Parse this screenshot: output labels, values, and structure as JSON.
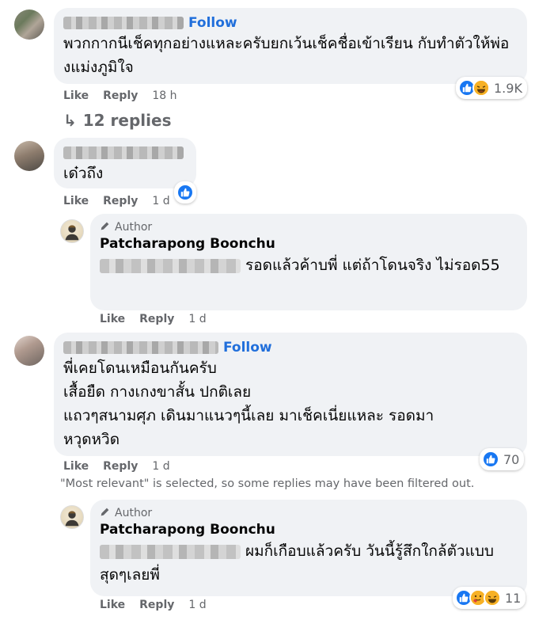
{
  "comments": [
    {
      "follow": "Follow",
      "text": "พวกกากนีเช็คทุกอย่างแหละครับยกเว้นเช็คชื่อเข้าเรียน กับทำตัวให้พ่องแม่งภูมิใจ",
      "actions": {
        "like": "Like",
        "reply": "Reply",
        "time": "18 h"
      },
      "reaction_count": "1.9K",
      "reaction_icons": [
        "like-icon",
        "haha-icon"
      ],
      "replies_link": "12 replies"
    },
    {
      "text": "เด๋วถึง",
      "actions": {
        "like": "Like",
        "reply": "Reply",
        "time": "1 d"
      },
      "reaction_icons": [
        "like-icon"
      ]
    },
    {
      "badge": "Author",
      "name": "Patcharapong Boonchu",
      "text": "รอดแล้วค้าบพี่ แต่ถ้าโดนจริง ไม่รอด55",
      "actions": {
        "like": "Like",
        "reply": "Reply",
        "time": "1 d"
      }
    },
    {
      "follow": "Follow",
      "lines": [
        "พี่เคยโดนเหมือนกันครับ",
        "เสื้อยืด กางเกงขาสั้น ปกติเลย",
        "แถวๆสนามศุภ เดินมาแนวๆนี้เลย มาเช็คเนี่ยแหละ รอดมา",
        "หวุดหวิด"
      ],
      "actions": {
        "like": "Like",
        "reply": "Reply",
        "time": "1 d"
      },
      "reaction_count": "70",
      "reaction_icons": [
        "like-icon"
      ]
    },
    {
      "badge": "Author",
      "name": "Patcharapong Boonchu",
      "text": "ผมก็เกือบแล้วครับ วันนี้รู้สึกใกล้ตัวแบบสุดๆเลยพี่",
      "actions": {
        "like": "Like",
        "reply": "Reply",
        "time": "1 d"
      },
      "reaction_count": "11",
      "reaction_icons": [
        "like-icon",
        "care-icon",
        "haha-icon"
      ]
    }
  ],
  "filter_note": "\"Most relevant\" is selected, so some replies may have been filtered out.",
  "colors": {
    "bubble": "#f0f2f5",
    "link": "#216fdb",
    "meta": "#65676b",
    "like": "#1877f2",
    "haha": "#f7b125"
  }
}
